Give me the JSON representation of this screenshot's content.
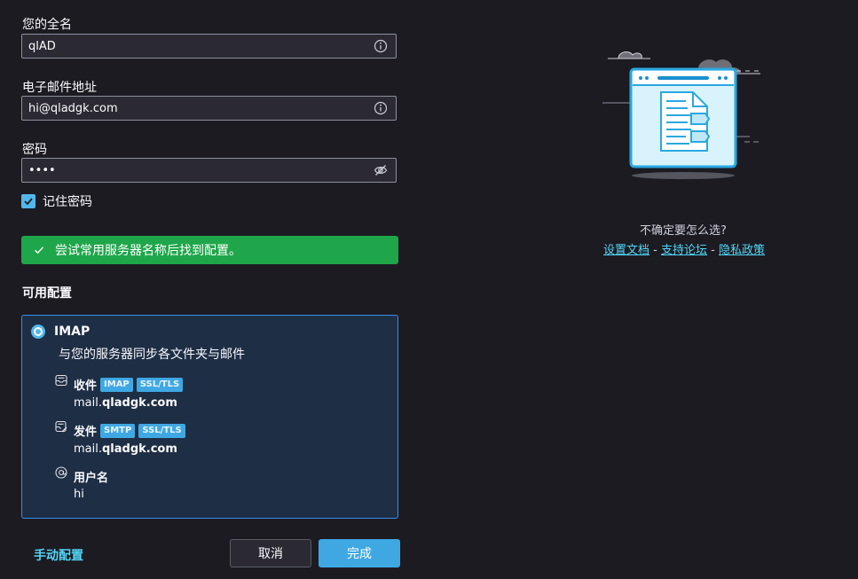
{
  "form": {
    "name_label": "您的全名",
    "name_value": "qlAD",
    "email_label": "电子邮件地址",
    "email_value": "hi@qladgk.com",
    "password_label": "密码",
    "password_value": "••••",
    "remember_label": "记住密码",
    "remember_checked": true
  },
  "status": {
    "message": "尝试常用服务器名称后找到配置。",
    "color": "#1fa64a"
  },
  "configs": {
    "title": "可用配置",
    "protocol": "IMAP",
    "description": "与您的服务器同步各文件夹与邮件",
    "incoming": {
      "label": "收件",
      "badges": [
        "IMAP",
        "SSL/TLS"
      ],
      "host_prefix": "mail.",
      "host_domain": "qladgk.com",
      "icon": "inbox-icon"
    },
    "outgoing": {
      "label": "发件",
      "badges": [
        "SMTP",
        "SSL/TLS"
      ],
      "host_prefix": "mail.",
      "host_domain": "qladgk.com",
      "icon": "outbox-icon"
    },
    "username": {
      "label": "用户名",
      "value": "hi",
      "icon": "at-sign-icon"
    }
  },
  "actions": {
    "manual": "手动配置",
    "cancel": "取消",
    "done": "完成"
  },
  "help": {
    "question": "不确定要怎么选?",
    "link_docs": "设置文档",
    "link_forum": "支持论坛",
    "link_privacy": "隐私政策",
    "separator": " - "
  },
  "colors": {
    "accent": "#3fa8e3",
    "link": "#52d6f5",
    "card_border": "#3a8ee6"
  }
}
